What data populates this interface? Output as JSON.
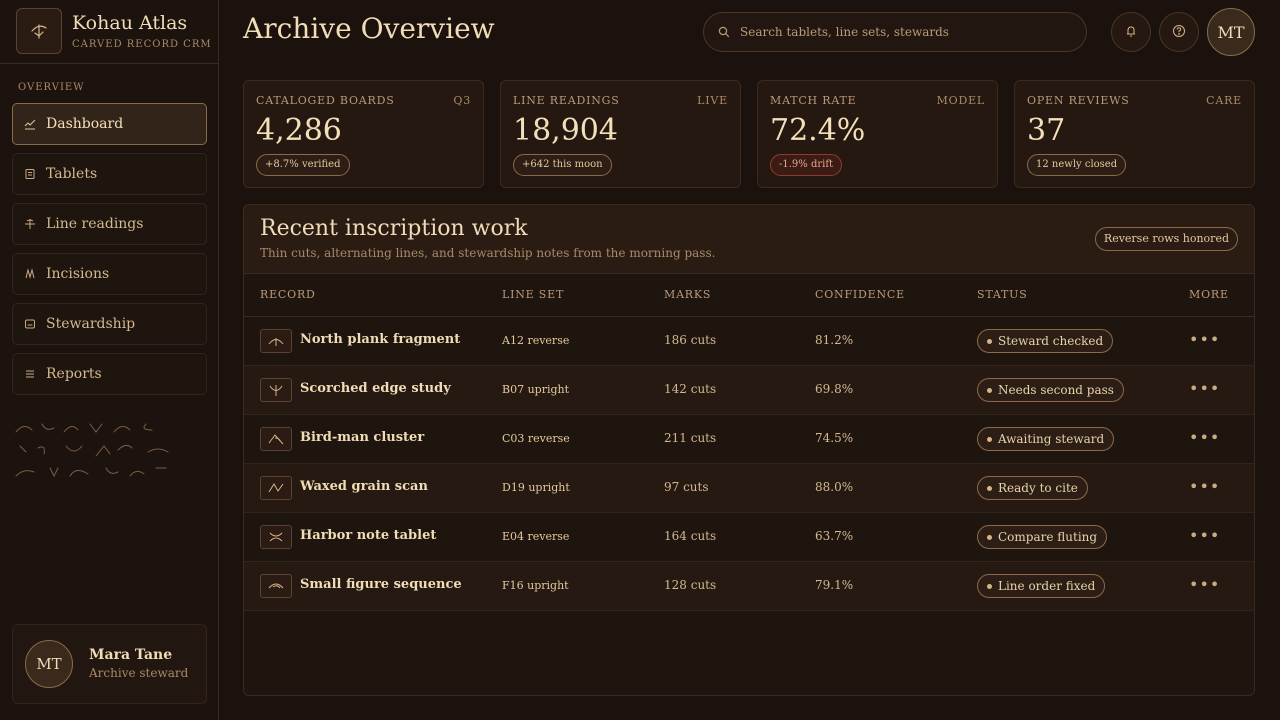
{
  "brand": {
    "name": "Kohau Atlas",
    "subtitle": "CARVED RECORD CRM"
  },
  "sidebar": {
    "section_label": "OVERVIEW",
    "items": [
      {
        "label": "Dashboard",
        "icon": "chart-line-icon",
        "active": true
      },
      {
        "label": "Tablets",
        "icon": "tablet-icon"
      },
      {
        "label": "Line readings",
        "icon": "line-reading-icon"
      },
      {
        "label": "Incisions",
        "icon": "incision-icon"
      },
      {
        "label": "Stewardship",
        "icon": "archive-box-icon"
      },
      {
        "label": "Reports",
        "icon": "list-icon"
      }
    ]
  },
  "user": {
    "initials": "MT",
    "name": "Mara Tane",
    "role": "Archive steward"
  },
  "header": {
    "title": "Archive Overview",
    "search_placeholder": "Search tablets, line sets, stewards",
    "avatar_initials": "MT"
  },
  "stats": [
    {
      "label": "CATALOGED BOARDS",
      "tag": "Q3",
      "value": "4,286",
      "pill": "+8.7% verified"
    },
    {
      "label": "LINE READINGS",
      "tag": "LIVE",
      "value": "18,904",
      "pill": "+642 this moon"
    },
    {
      "label": "MATCH RATE",
      "tag": "MODEL",
      "value": "72.4%",
      "pill": "-1.9% drift"
    },
    {
      "label": "OPEN REVIEWS",
      "tag": "CARE",
      "value": "37",
      "pill": "12 newly closed"
    }
  ],
  "panel": {
    "title": "Recent inscription work",
    "subtitle": "Thin cuts, alternating lines, and stewardship notes from the morning pass.",
    "badge": "Reverse rows honored",
    "columns": [
      "RECORD",
      "LINE SET",
      "MARKS",
      "CONFIDENCE",
      "STATUS",
      "MORE"
    ],
    "rows": [
      {
        "record": "North plank fragment",
        "line_set": "A12 reverse",
        "marks": "186 cuts",
        "confidence": "81.2%",
        "status": "Steward checked"
      },
      {
        "record": "Scorched edge study",
        "line_set": "B07 upright",
        "marks": "142 cuts",
        "confidence": "69.8%",
        "status": "Needs second pass"
      },
      {
        "record": "Bird-man cluster",
        "line_set": "C03 reverse",
        "marks": "211 cuts",
        "confidence": "74.5%",
        "status": "Awaiting steward"
      },
      {
        "record": "Waxed grain scan",
        "line_set": "D19 upright",
        "marks": "97 cuts",
        "confidence": "88.0%",
        "status": "Ready to cite"
      },
      {
        "record": "Harbor note tablet",
        "line_set": "E04 reverse",
        "marks": "164 cuts",
        "confidence": "63.7%",
        "status": "Compare fluting"
      },
      {
        "record": "Small figure sequence",
        "line_set": "F16 upright",
        "marks": "128 cuts",
        "confidence": "79.1%",
        "status": "Line order fixed"
      }
    ]
  },
  "colors": {
    "accent": "#8a6a4a",
    "text": "#f0dcb6",
    "background": "#1a110c",
    "negative": "#8a3d30"
  }
}
